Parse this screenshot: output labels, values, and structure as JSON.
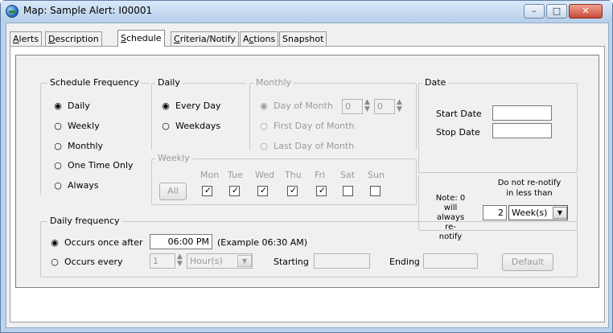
{
  "window": {
    "title": "Map: Sample   Alert: I00001",
    "minimize_glyph": "–",
    "maximize_glyph": "□",
    "close_glyph": "✕"
  },
  "tabs": [
    {
      "label": "Alerts",
      "u": "A",
      "rest": "lerts"
    },
    {
      "label": "Description",
      "u": "D",
      "rest": "escription"
    },
    {
      "label": "Schedule",
      "u": "S",
      "rest": "chedule"
    },
    {
      "label": "Criteria/Notify",
      "u": "C",
      "rest": "riteria/Notify"
    },
    {
      "label": "Actions",
      "pre": "A",
      "u": "c",
      "rest": "tions"
    },
    {
      "label": "Snapshot"
    }
  ],
  "schedule_frequency": {
    "label": "Schedule Frequency",
    "options": [
      "Daily",
      "Weekly",
      "Monthly",
      "One Time Only",
      "Always"
    ],
    "selected": "Daily"
  },
  "daily": {
    "label": "Daily",
    "options": [
      "Every Day",
      "Weekdays"
    ],
    "selected": "Every Day"
  },
  "monthly": {
    "label": "Monthly",
    "options": [
      "Day of Month",
      "First Day of Month",
      "Last Day of Month"
    ],
    "selected": "Day of Month",
    "day_value_1": "0",
    "day_value_2": "0"
  },
  "date": {
    "label": "Date",
    "start_label": "Start Date",
    "stop_label": "Stop Date",
    "start_value": "",
    "stop_value": ""
  },
  "weekly": {
    "label": "Weekly",
    "all_button": "All",
    "days": [
      {
        "name": "Mon",
        "checked": true
      },
      {
        "name": "Tue",
        "checked": true
      },
      {
        "name": "Wed",
        "checked": true
      },
      {
        "name": "Thu",
        "checked": true
      },
      {
        "name": "Fri",
        "checked": true
      },
      {
        "name": "Sat",
        "checked": false
      },
      {
        "name": "Sun",
        "checked": false
      }
    ]
  },
  "renotify": {
    "note_line1": "Note: 0",
    "note_line2": "will always",
    "note_line3": "re-notify",
    "header_line1": "Do not re-notify",
    "header_line2": "in less than",
    "value": "2",
    "unit": "Week(s)"
  },
  "daily_frequency": {
    "label": "Daily frequency",
    "once_label": "Occurs once after",
    "once_time": "06:00 PM",
    "example": "(Example  06:30 AM)",
    "every_label": "Occurs every",
    "every_value": "1",
    "every_unit": "Hour(s)",
    "starting_label": "Starting",
    "starting_value": "",
    "ending_label": "Ending",
    "ending_value": "",
    "default_button": "Default",
    "selected": "Occurs once after"
  },
  "icons": {
    "radio_on": "◉",
    "radio_off": "○",
    "check": "✓",
    "spin_up": "▲",
    "spin_down": "▼",
    "dropdown": "▼"
  }
}
